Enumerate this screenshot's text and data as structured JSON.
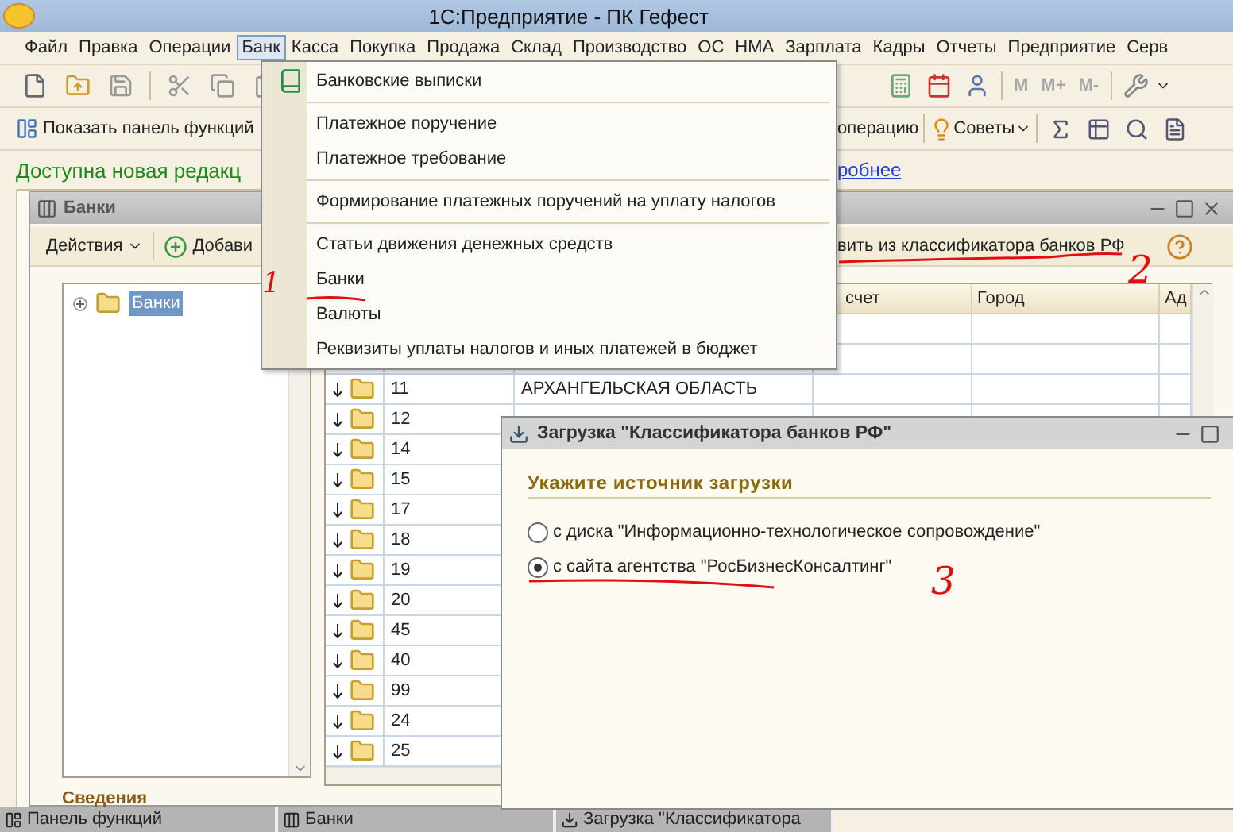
{
  "window": {
    "title": "1С:Предприятие - ПК Гефест"
  },
  "menu_bar": [
    {
      "label": "Файл",
      "selected": false
    },
    {
      "label": "Правка",
      "selected": false
    },
    {
      "label": "Операции",
      "selected": false
    },
    {
      "label": "Банк",
      "selected": true
    },
    {
      "label": "Касса",
      "selected": false
    },
    {
      "label": "Покупка",
      "selected": false
    },
    {
      "label": "Продажа",
      "selected": false
    },
    {
      "label": "Склад",
      "selected": false
    },
    {
      "label": "Производство",
      "selected": false
    },
    {
      "label": "ОС",
      "selected": false
    },
    {
      "label": "НМА",
      "selected": false
    },
    {
      "label": "Зарплата",
      "selected": false
    },
    {
      "label": "Кадры",
      "selected": false
    },
    {
      "label": "Отчеты",
      "selected": false
    },
    {
      "label": "Предприятие",
      "selected": false
    },
    {
      "label": "Серв",
      "selected": false
    }
  ],
  "toolbar_memory": [
    {
      "label": "M",
      "disabled": true
    },
    {
      "label": "M+",
      "disabled": true
    },
    {
      "label": "M-",
      "disabled": true
    }
  ],
  "function_bar": {
    "show_panel": "Показать панель функций",
    "operation": "операцию",
    "tips": "Советы"
  },
  "notice": {
    "text": "Доступна новая редакц",
    "link": "робнее"
  },
  "bank_menu": [
    {
      "kind": "item",
      "label": "Банковские выписки",
      "has_icon": true
    },
    {
      "kind": "separator"
    },
    {
      "kind": "item",
      "label": "Платежное поручение",
      "has_icon": false
    },
    {
      "kind": "item",
      "label": "Платежное требование",
      "has_icon": false
    },
    {
      "kind": "separator"
    },
    {
      "kind": "item",
      "label": "Формирование платежных поручений на уплату налогов",
      "has_icon": false
    },
    {
      "kind": "separator"
    },
    {
      "kind": "item",
      "label": "Статьи движения денежных средств",
      "has_icon": false
    },
    {
      "kind": "item",
      "label": "Банки",
      "has_icon": false
    },
    {
      "kind": "item",
      "label": "Валюты",
      "has_icon": false
    },
    {
      "kind": "item",
      "label": "Реквизиты уплаты налогов и иных платежей в бюджет",
      "has_icon": false
    }
  ],
  "banks_window": {
    "title": "Банки",
    "actions": "Действия",
    "add": "Добави",
    "load": "вить из классификатора банков РФ",
    "tree": [
      {
        "label": "Банки",
        "selected": true,
        "expanded": false
      }
    ],
    "table": {
      "columns": [
        {
          "label": "счет"
        },
        {
          "label": "Город"
        },
        {
          "label": "Ад"
        }
      ],
      "rows": [
        {
          "code": "11",
          "name": "АРХАНГЕЛЬСКАЯ ОБЛАСТЬ"
        },
        {
          "code": "12"
        },
        {
          "code": "14"
        },
        {
          "code": "15"
        },
        {
          "code": "17"
        },
        {
          "code": "18"
        },
        {
          "code": "19"
        },
        {
          "code": "20"
        },
        {
          "code": "45"
        },
        {
          "code": "40"
        },
        {
          "code": "99"
        },
        {
          "code": "24"
        },
        {
          "code": "25"
        }
      ]
    },
    "details_label": "Сведения"
  },
  "dialog": {
    "title": "Загрузка \"Классификатора банков РФ\"",
    "heading": "Укажите источник загрузки",
    "options": [
      {
        "label": "с диска \"Информационно-технологическое сопровождение\"",
        "selected": false
      },
      {
        "label": "с сайта агентства \"РосБизнесКонсалтинг\"",
        "selected": true
      }
    ]
  },
  "taskbar": [
    {
      "label": "Панель функций"
    },
    {
      "label": "Банки"
    },
    {
      "label": "Загрузка \"Классификатора"
    }
  ],
  "annotations": [
    {
      "label": "1"
    },
    {
      "label": "2"
    },
    {
      "label": "3"
    }
  ]
}
